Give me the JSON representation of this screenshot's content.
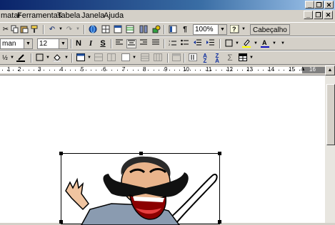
{
  "menu": {
    "items": [
      "matar",
      "Ferramentas",
      "Tabela",
      "Janela",
      "Ajuda"
    ]
  },
  "window_buttons": {
    "minimize": "_",
    "restore": "❐",
    "close": "✕"
  },
  "doc_buttons": {
    "minimize": "_",
    "restore": "❐",
    "close": "✕"
  },
  "standard_toolbar": {
    "zoom": "100%",
    "header_button": "Cabeçalho"
  },
  "format_toolbar": {
    "font": "man",
    "size": "12"
  },
  "ruler": {
    "numbers": [
      "1",
      "2",
      "3",
      "4",
      "5",
      "6",
      "7",
      "8",
      "9",
      "10",
      "11",
      "12",
      "13",
      "14",
      "15",
      "16"
    ]
  },
  "colors": {
    "title_start": "#0a246a",
    "title_end": "#a6caf0",
    "font_color": "#1010c0",
    "highlight": "#ffff00"
  },
  "icons": [
    "scissors-icon",
    "copy-icon",
    "paste-icon",
    "format-painter-icon",
    "undo-icon",
    "redo-icon",
    "hyperlink-icon",
    "tables-icon",
    "insert-table-icon",
    "excel-icon",
    "columns-icon",
    "drawing-icon",
    "document-map-icon",
    "pilcrow-icon",
    "help-icon",
    "bold-icon",
    "italic-icon",
    "strikethrough-icon",
    "align-left-icon",
    "align-center-icon",
    "align-right-icon",
    "justify-icon",
    "numbering-icon",
    "bullets-icon",
    "decrease-indent-icon",
    "increase-indent-icon",
    "border-icon",
    "highlight-icon",
    "font-color-icon"
  ]
}
